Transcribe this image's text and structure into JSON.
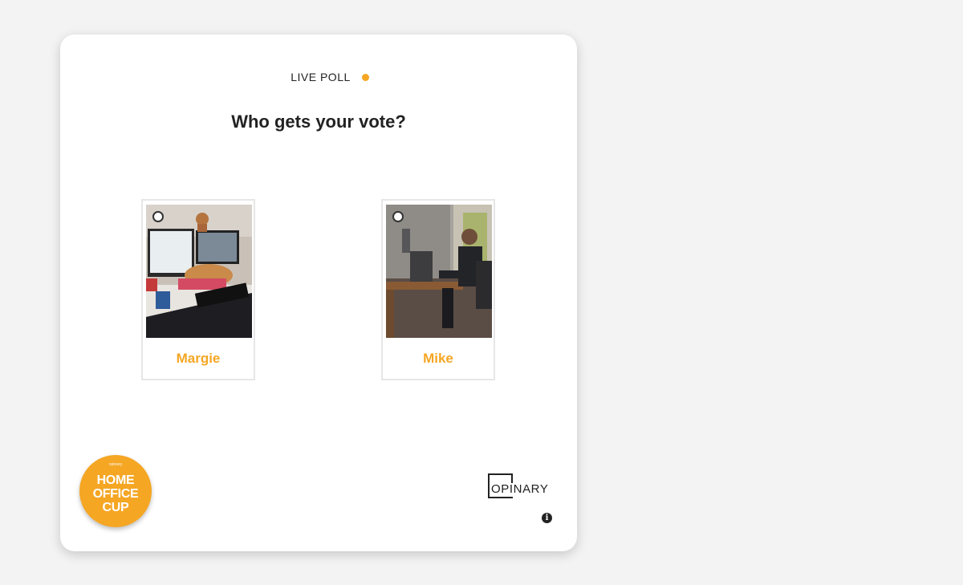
{
  "poll": {
    "live_label": "LIVE POLL",
    "question": "Who gets your vote?",
    "options": [
      {
        "name": "Margie",
        "selected": false,
        "photo_icon": "home-office-desk-with-cat-photo"
      },
      {
        "name": "Mike",
        "selected": false,
        "photo_icon": "man-at-desk-photo"
      }
    ]
  },
  "badge": {
    "small_text": "opinary",
    "text": "HOME OFFICE CUP"
  },
  "brand": {
    "name": "OPINARY"
  },
  "info": {
    "glyph": "i"
  },
  "colors": {
    "accent": "#f5a623",
    "background": "#f3f3f3",
    "card": "#ffffff",
    "text": "#222222"
  }
}
